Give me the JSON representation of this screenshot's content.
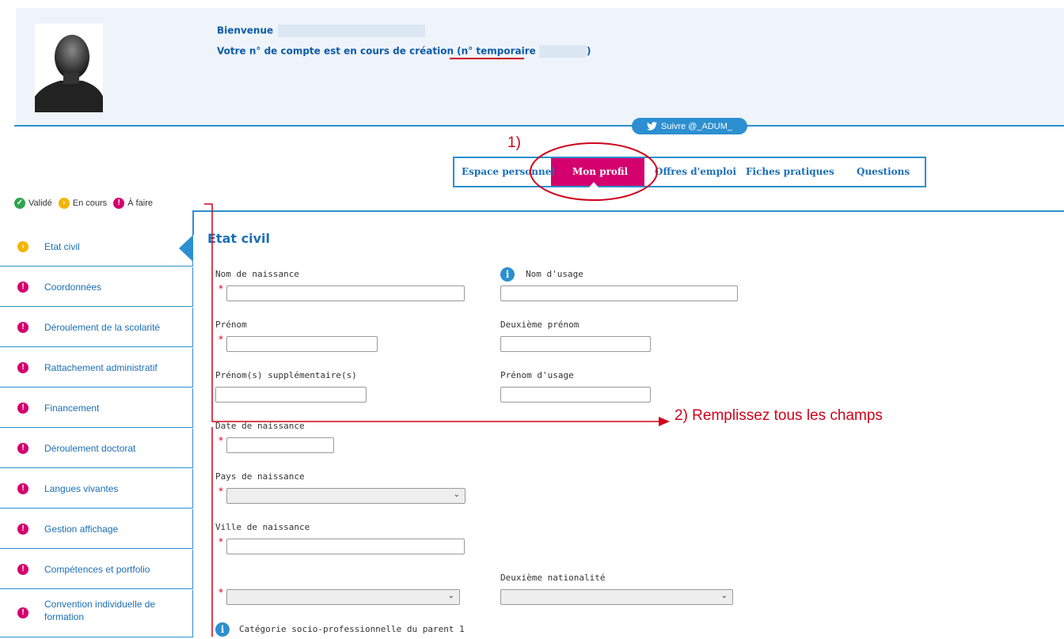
{
  "header": {
    "welcome_label": "Bienvenue",
    "account_text": "Votre n° de compte est en cours de création (",
    "temp_label": "n° temporaire",
    "account_close": ")"
  },
  "twitter": {
    "label": "Suivre @_ADUM_"
  },
  "nav": {
    "items": [
      "Espace personnel",
      "Mon profil",
      "Offres d'emploi",
      "Fiches pratiques",
      "Questions"
    ],
    "active_index": 1
  },
  "legend": {
    "valid": "Validé",
    "in_progress": "En cours",
    "todo": "À faire"
  },
  "sidebar": {
    "items": [
      {
        "label": "Etat civil",
        "status": "in_progress"
      },
      {
        "label": "Coordonnées",
        "status": "todo"
      },
      {
        "label": "Déroulement de la scolarité",
        "status": "todo"
      },
      {
        "label": "Rattachement administratif",
        "status": "todo"
      },
      {
        "label": "Financement",
        "status": "todo"
      },
      {
        "label": "Déroulement doctorat",
        "status": "todo"
      },
      {
        "label": "Langues vivantes",
        "status": "todo"
      },
      {
        "label": "Gestion affichage",
        "status": "todo"
      },
      {
        "label": "Compétences et portfolio",
        "status": "todo"
      },
      {
        "label": "Convention individuelle de formation",
        "status": "todo"
      }
    ]
  },
  "form": {
    "title": "Etat civil",
    "nom_naissance": "Nom de naissance",
    "nom_usage": "Nom d'usage",
    "prenom": "Prénom",
    "deuxieme_prenom": "Deuxième prénom",
    "prenoms_supp": "Prénom(s) supplémentaire(s)",
    "prenom_usage": "Prénom d'usage",
    "date_naissance": "Date de naissance",
    "pays_naissance": "Pays de naissance",
    "ville_naissance": "Ville de naissance",
    "deuxieme_nationalite": "Deuxième nationalité",
    "categorie_parent": "Catégorie socio-professionnelle du parent 1",
    "required_mark": "*"
  },
  "annotations": {
    "step1": "1)",
    "step2": "2) Remplissez tous les champs",
    "color": "#d0021b"
  },
  "colors": {
    "accent": "#2b8fd0",
    "active_tab": "#d3006e",
    "valid": "#2ea44f",
    "in_progress": "#f5b400",
    "todo": "#d3006e"
  }
}
